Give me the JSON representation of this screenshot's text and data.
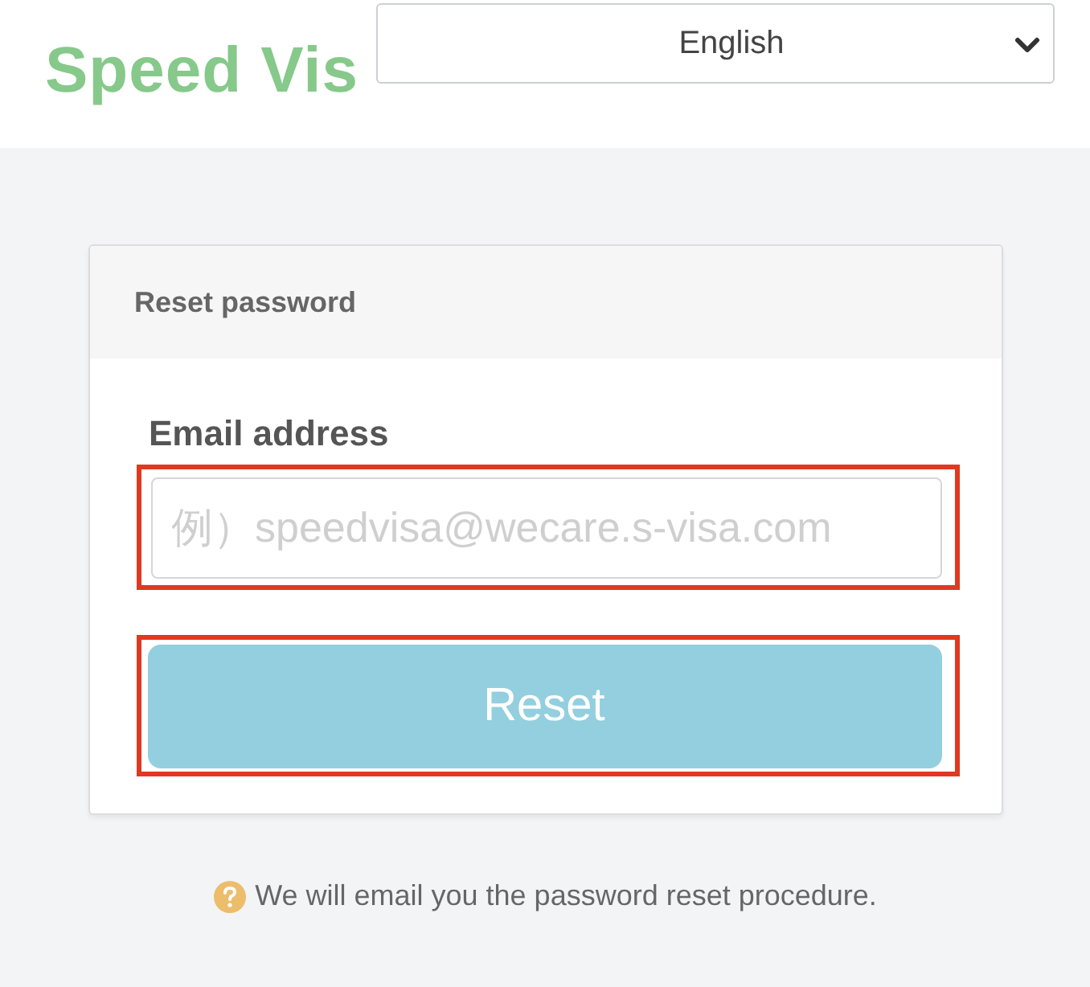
{
  "logo": "Speed Vis",
  "language_select": {
    "value": "English"
  },
  "card": {
    "title": "Reset password",
    "email_label": "Email address",
    "email_field": {
      "placeholder": "例）speedvisa@wecare.s-visa.com",
      "highlighted": true
    },
    "reset_button": {
      "label": "Reset",
      "highlighted": true
    }
  },
  "help_text": "We will email you the password reset procedure."
}
